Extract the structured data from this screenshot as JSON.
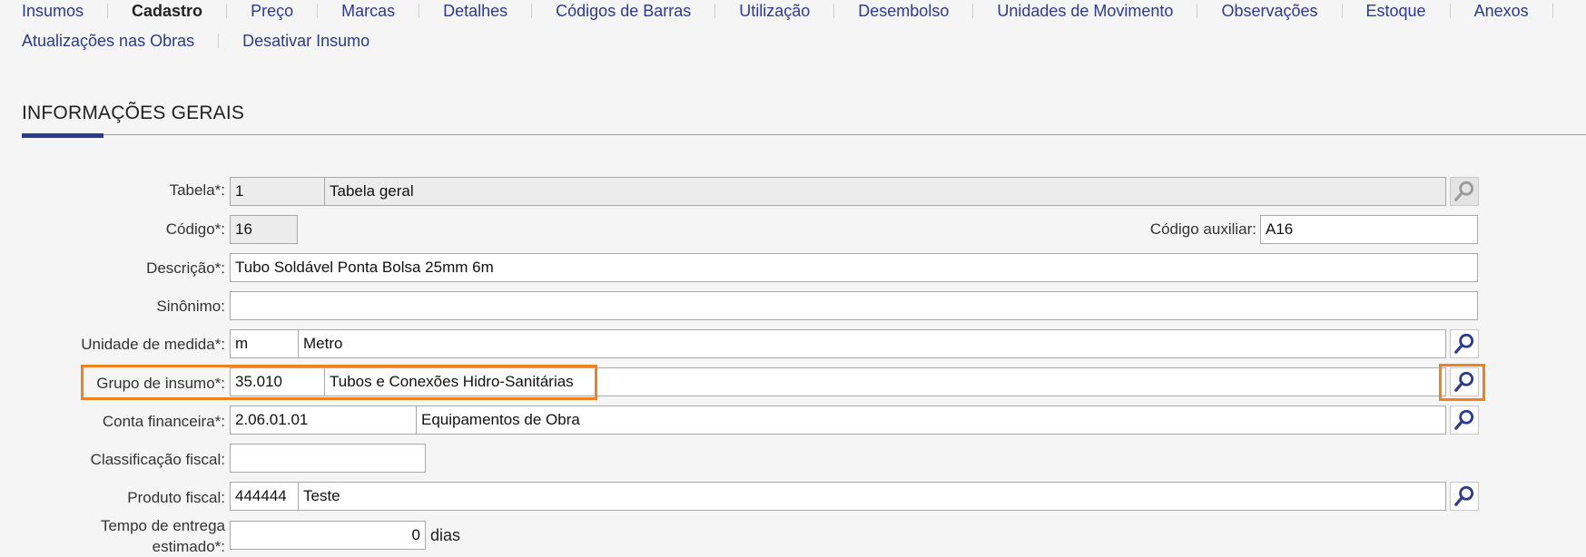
{
  "nav": {
    "row1": [
      "Insumos",
      "Cadastro",
      "Preço",
      "Marcas",
      "Detalhes",
      "Códigos de Barras",
      "Utilização",
      "Desembolso",
      "Unidades de Movimento",
      "Observações",
      "Estoque",
      "Anexos"
    ],
    "row2": [
      "Atualizações nas Obras",
      "Desativar Insumo"
    ],
    "active": "Cadastro"
  },
  "section": {
    "title": "INFORMAÇÕES GERAIS"
  },
  "form": {
    "tabela": {
      "label": "Tabela*:",
      "code": "1",
      "name": "Tabela geral"
    },
    "codigo": {
      "label": "Código*:",
      "value": "16"
    },
    "codigo_aux": {
      "label": "Código auxiliar:",
      "value": "A16"
    },
    "descricao": {
      "label": "Descrição*:",
      "value": "Tubo Soldável Ponta Bolsa 25mm 6m"
    },
    "sinonimo": {
      "label": "Sinônimo:",
      "value": ""
    },
    "unidade": {
      "label": "Unidade de medida*:",
      "code": "m",
      "name": "Metro"
    },
    "grupo": {
      "label": "Grupo de insumo*:",
      "code": "35.010",
      "name": "Tubos e Conexões Hidro-Sanitárias"
    },
    "conta": {
      "label": "Conta financeira*:",
      "code": "2.06.01.01",
      "name": "Equipamentos de Obra"
    },
    "classificacao": {
      "label": "Classificação fiscal:",
      "value": ""
    },
    "produto": {
      "label": "Produto fiscal:",
      "code": "444444",
      "name": "Teste"
    },
    "tempo": {
      "label_line1": "Tempo de entrega",
      "label_line2": "estimado*:",
      "value": "0",
      "unit": "dias"
    }
  },
  "colors": {
    "accent": "#2c3a8f",
    "highlight": "#f0821e"
  },
  "icons": {
    "search": "search-icon"
  }
}
